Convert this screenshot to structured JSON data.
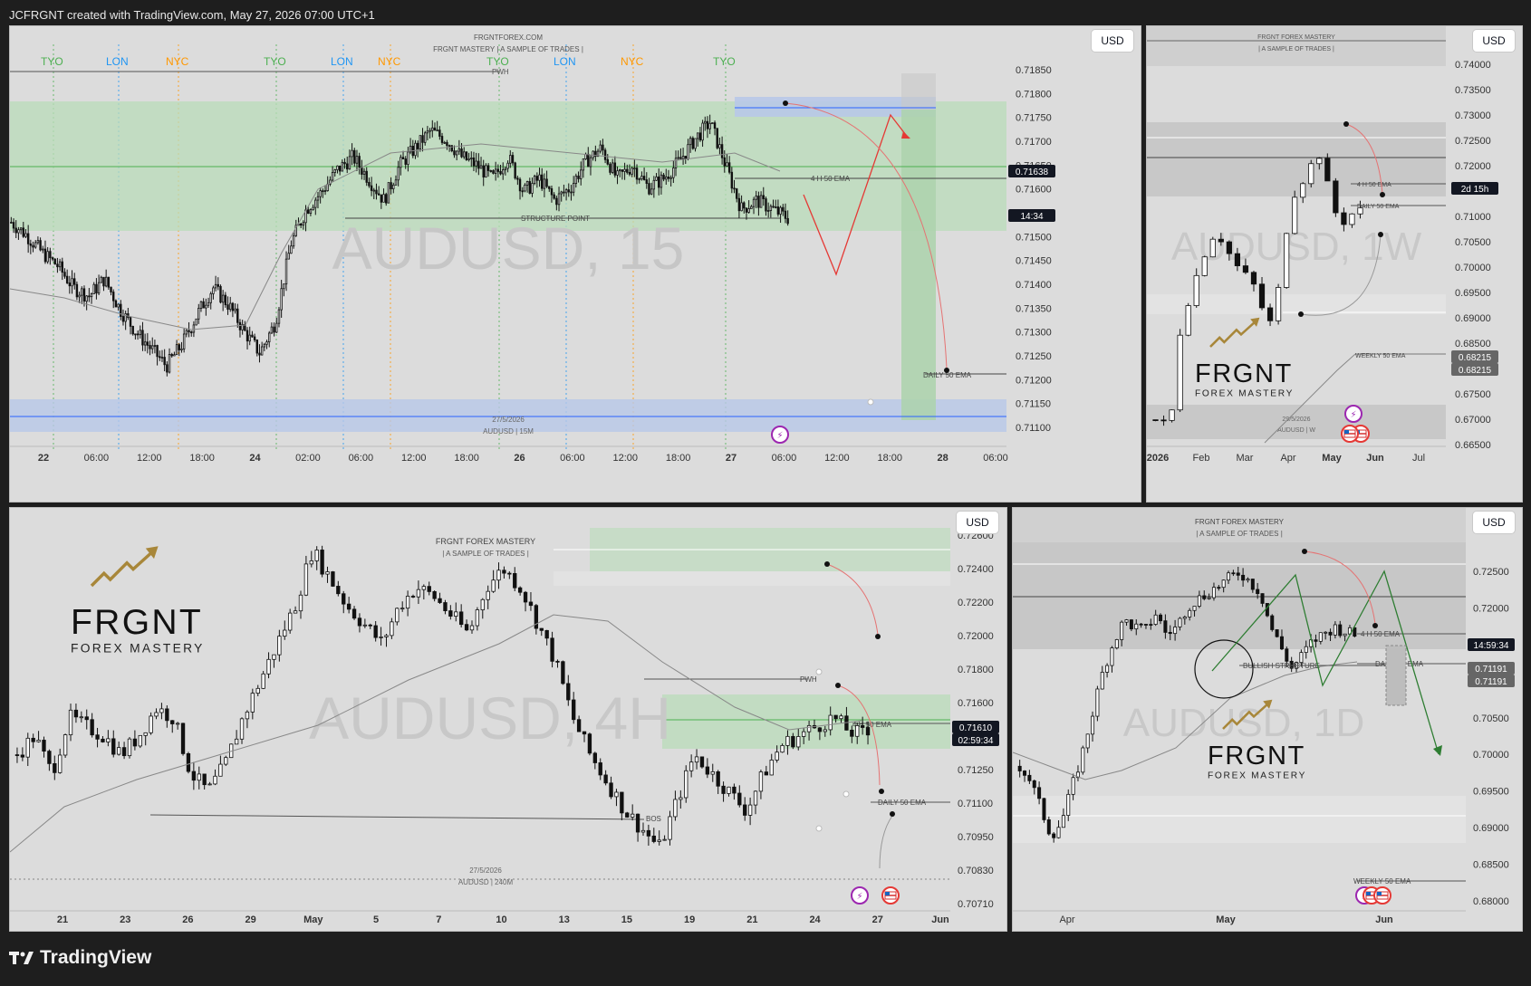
{
  "header": {
    "text": "JCFRGNT created with TradingView.com, May 27, 2026 07:00 UTC+1"
  },
  "footer": {
    "brand": "TradingView",
    "icon": "tradingview-logo-icon"
  },
  "panels": {
    "m15": {
      "currency": "USD",
      "watermark": "AUDUSD, 15",
      "brand_line1": "FRGNTFOREX.COM",
      "brand_line2": "FRGNT MASTERY  |  A SAMPLE OF TRADES |",
      "date_stamp": "27/5/2026",
      "symbol_stamp": "AUDUSD | 15M",
      "price_badge": "0.71638",
      "countdown_badge": "14:34",
      "label_pwh": "PWH",
      "label_structure": "STRUCTURE POINT",
      "label_4h_ema": "4 H 50 EMA",
      "label_daily_ema": "DAILY 50 EMA",
      "sessions": [
        {
          "name": "TYO",
          "color": "#4caf50"
        },
        {
          "name": "LON",
          "color": "#2196f3"
        },
        {
          "name": "NYC",
          "color": "#ff9800"
        },
        {
          "name": "TYO",
          "color": "#4caf50"
        },
        {
          "name": "LON",
          "color": "#2196f3"
        },
        {
          "name": "NYC",
          "color": "#ff9800"
        },
        {
          "name": "TYO",
          "color": "#4caf50"
        },
        {
          "name": "LON",
          "color": "#2196f3"
        },
        {
          "name": "NYC",
          "color": "#ff9800"
        },
        {
          "name": "TYO",
          "color": "#4caf50"
        }
      ],
      "x_ticks": [
        "22",
        "06:00",
        "12:00",
        "18:00",
        "24",
        "02:00",
        "06:00",
        "12:00",
        "18:00",
        "26",
        "06:00",
        "12:00",
        "18:00",
        "27",
        "06:00",
        "12:00",
        "18:00",
        "28",
        "06:00"
      ],
      "y_ticks": [
        "0.71850",
        "0.71800",
        "0.71750",
        "0.71700",
        "0.71650",
        "0.71600",
        "0.71550",
        "0.71500",
        "0.71450",
        "0.71400",
        "0.71350",
        "0.71300",
        "0.71250",
        "0.71200",
        "0.71150",
        "0.71100"
      ]
    },
    "w1": {
      "currency": "USD",
      "watermark": "AUDUSD, 1W",
      "brand_line1": "FRGNT FOREX MASTERY",
      "brand_line2": "|  A SAMPLE OF TRADES |",
      "logo_main": "FRGNT",
      "logo_sub": "FOREX MASTERY",
      "date_stamp": "29/5/2026",
      "symbol_stamp": "AUDUSD | W",
      "countdown_badge": "2d 15h",
      "price_badge_1": "0.68215",
      "price_badge_2": "0.68215",
      "label_4h_ema": "4 H 50 EMA",
      "label_daily_ema": "DAILY 50 EMA",
      "label_weekly_ema": "WEEKLY 50 EMA",
      "x_ticks": [
        "2026",
        "Feb",
        "Mar",
        "Apr",
        "May",
        "Jun",
        "Jul"
      ],
      "y_ticks": [
        "0.74000",
        "0.73500",
        "0.73000",
        "0.72500",
        "0.72000",
        "0.71500",
        "0.71000",
        "0.70500",
        "0.70000",
        "0.69500",
        "0.69000",
        "0.68500",
        "0.68000",
        "0.67500",
        "0.67000",
        "0.66500"
      ]
    },
    "h4": {
      "currency": "USD",
      "watermark": "AUDUSD, 4H",
      "brand_line1": "FRGNT FOREX MASTERY",
      "brand_line2": "|  A SAMPLE OF TRADES |",
      "logo_main": "FRGNT",
      "logo_sub": "FOREX MASTERY",
      "date_stamp": "27/5/2026",
      "symbol_stamp": "AUDUSD | 240M",
      "price_badge": "0.71610",
      "countdown_badge": "02:59:34",
      "label_pwh": "PWH",
      "label_bos": "BOS",
      "label_4h_ema": "4 H 50 EMA",
      "label_daily_ema": "DAILY 50 EMA",
      "x_ticks": [
        "21",
        "23",
        "26",
        "29",
        "May",
        "5",
        "7",
        "10",
        "13",
        "15",
        "19",
        "21",
        "24",
        "27",
        "Jun"
      ],
      "y_ticks": [
        "0.72600",
        "0.72400",
        "0.72200",
        "0.72000",
        "0.71800",
        "0.71600",
        "0.71400",
        "0.71250",
        "0.71100",
        "0.70950",
        "0.70830",
        "0.70710"
      ]
    },
    "d1": {
      "currency": "USD",
      "watermark": "AUDUSD, 1D",
      "brand_line1": "FRGNT FOREX MASTERY",
      "brand_line2": "|  A SAMPLE OF TRADES |",
      "logo_main": "FRGNT",
      "logo_sub": "FOREX MASTERY",
      "countdown_badge": "14:59:34",
      "price_badge_1": "0.71191",
      "price_badge_2": "0.71191",
      "label_bullish": "BULLISH STRUCTURE",
      "label_4h_ema": "4 H 50 EMA",
      "label_daily_ema": "DAILY 50 EMA",
      "label_weekly_ema": "WEEKLY 50 EMA",
      "x_ticks": [
        "Apr",
        "May",
        "Jun"
      ],
      "y_ticks": [
        "0.72500",
        "0.72000",
        "0.71500",
        "0.71000",
        "0.70500",
        "0.70000",
        "0.69500",
        "0.69000",
        "0.68500",
        "0.68000"
      ]
    }
  },
  "colors": {
    "background": "#dcdcdc",
    "green_zone": "#b9dcb9",
    "blue_zone": "#b8c8e8",
    "candle": "#111111",
    "projection_red": "#e53935",
    "projection_green": "#2e7d32",
    "ema_gray": "#888888"
  },
  "chart_data": [
    {
      "type": "candlestick",
      "panel": "m15",
      "title": "AUDUSD, 15",
      "ylim": [
        0.71075,
        0.719
      ],
      "series": [
        {
          "values": [
            0.7155,
            0.7152,
            0.7148,
            0.7145,
            0.714,
            0.7138,
            0.7142,
            0.7135,
            0.713,
            0.7126,
            0.7122,
            0.7127,
            0.7134,
            0.714,
            0.7136,
            0.713,
            0.7125,
            0.7132,
            0.715,
            0.7158,
            0.7162,
            0.7167,
            0.717,
            0.7165,
            0.716,
            0.7168,
            0.7172,
            0.7176,
            0.7174,
            0.717,
            0.7168,
            0.7165,
            0.717,
            0.7162,
            0.7165,
            0.716,
            0.7163,
            0.7169,
            0.7172,
            0.7165,
            0.7168,
            0.7163,
            0.7165,
            0.7169,
            0.7174,
            0.7178,
            0.7168,
            0.7158,
            0.716,
            0.7158,
            0.7156
          ]
        }
      ]
    },
    {
      "type": "candlestick",
      "panel": "w1",
      "title": "AUDUSD, 1W",
      "ylim": [
        0.665,
        0.742
      ],
      "series": [
        {
          "values": [
            0.67,
            0.669,
            0.672,
            0.69,
            0.695,
            0.7,
            0.705,
            0.708,
            0.706,
            0.702,
            0.7,
            0.698,
            0.696,
            0.689,
            0.69,
            0.705,
            0.715,
            0.718,
            0.72,
            0.725,
            0.718,
            0.712,
            0.71,
            0.7115,
            0.712
          ]
        }
      ]
    },
    {
      "type": "candlestick",
      "panel": "h4",
      "title": "AUDUSD, 4H",
      "ylim": [
        0.707,
        0.7268
      ],
      "series": [
        {
          "values": [
            0.715,
            0.716,
            0.714,
            0.717,
            0.7165,
            0.716,
            0.715,
            0.716,
            0.7175,
            0.717,
            0.714,
            0.713,
            0.7145,
            0.717,
            0.719,
            0.721,
            0.723,
            0.726,
            0.7245,
            0.723,
            0.722,
            0.721,
            0.723,
            0.724,
            0.7235,
            0.7225,
            0.7215,
            0.724,
            0.725,
            0.724,
            0.722,
            0.72,
            0.717,
            0.715,
            0.7135,
            0.712,
            0.711,
            0.71,
            0.7125,
            0.715,
            0.714,
            0.713,
            0.712,
            0.714,
            0.7155,
            0.716,
            0.7165,
            0.717,
            0.7162,
            0.7161
          ]
        }
      ]
    },
    {
      "type": "candlestick",
      "panel": "d1",
      "title": "AUDUSD, 1D",
      "ylim": [
        0.6785,
        0.728
      ],
      "series": [
        {
          "values": [
            0.698,
            0.696,
            0.692,
            0.688,
            0.69,
            0.695,
            0.7,
            0.706,
            0.712,
            0.716,
            0.719,
            0.718,
            0.7175,
            0.72,
            0.717,
            0.718,
            0.721,
            0.722,
            0.723,
            0.724,
            0.725,
            0.726,
            0.7245,
            0.723,
            0.718,
            0.715,
            0.712,
            0.714,
            0.716,
            0.717,
            0.718,
            0.7175,
            0.7168
          ]
        }
      ]
    }
  ]
}
